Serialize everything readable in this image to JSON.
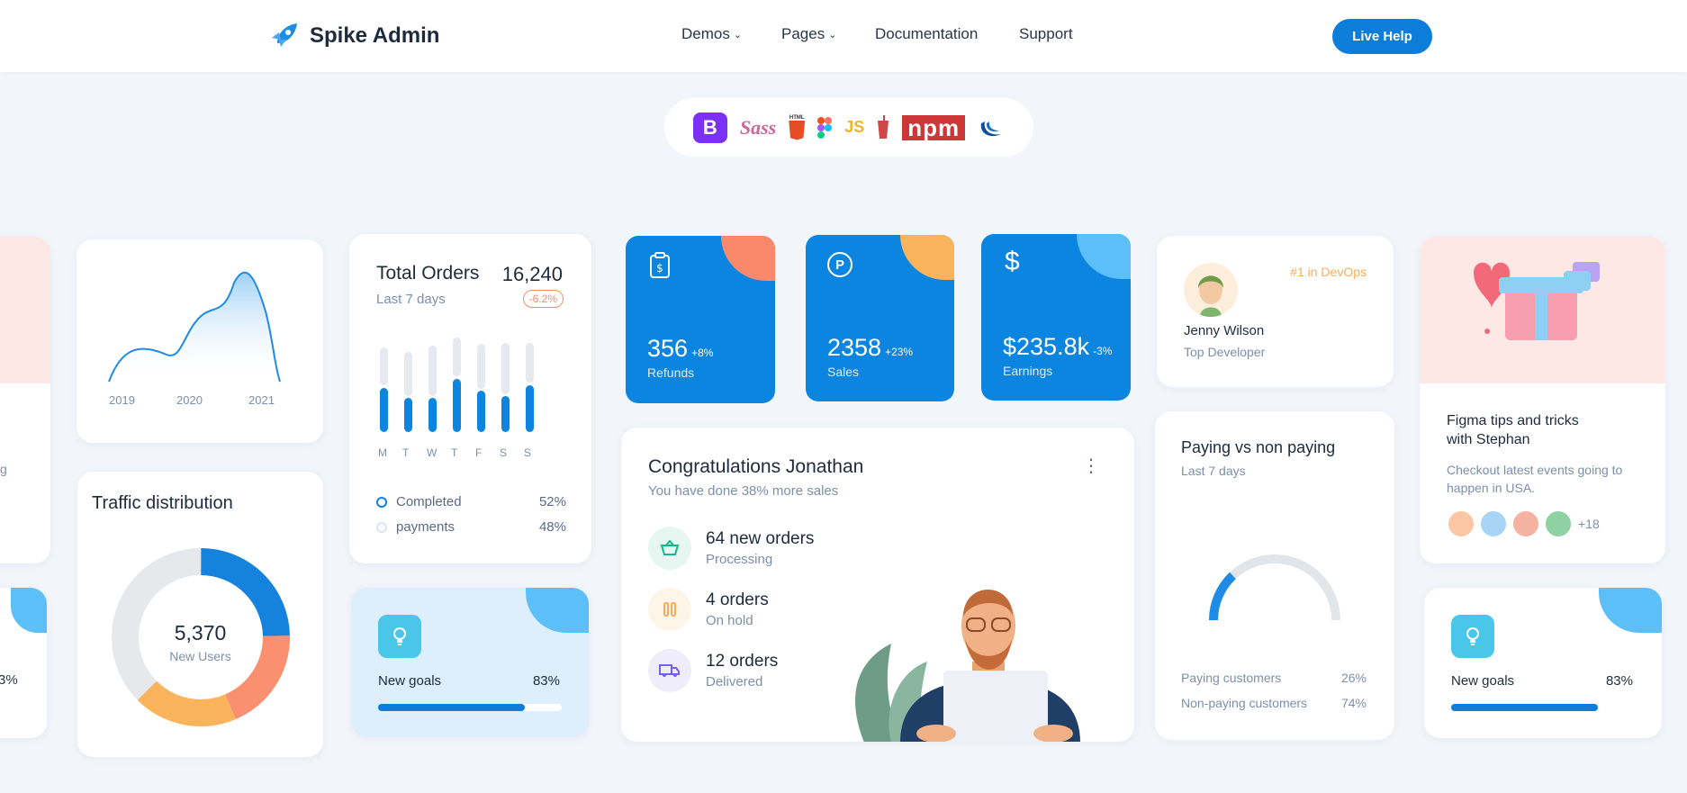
{
  "header": {
    "brand": "Spike Admin",
    "nav": [
      "Demos",
      "Pages",
      "Documentation",
      "Support"
    ],
    "live_help": "Live Help"
  },
  "tech": [
    "B",
    "Sass",
    "HTML",
    "JS",
    "npm"
  ],
  "area_chart": {
    "x": [
      "2019",
      "2020",
      "2021"
    ]
  },
  "total_orders": {
    "title": "Total Orders",
    "value": "16,240",
    "subtitle": "Last 7 days",
    "change": "-6.2%",
    "days": [
      "M",
      "T",
      "W",
      "T",
      "F",
      "S",
      "S"
    ],
    "bars": [
      52,
      40,
      40,
      62,
      48,
      42,
      55
    ],
    "legend": [
      {
        "label": "Completed",
        "value": "52%"
      },
      {
        "label": "payments",
        "value": "48%"
      }
    ]
  },
  "traffic": {
    "title": "Traffic distribution",
    "value": "5,370",
    "label": "New Users"
  },
  "stats": [
    {
      "value": "356",
      "change": "+8%",
      "label": "Refunds"
    },
    {
      "value": "2358",
      "change": "+23%",
      "label": "Sales"
    },
    {
      "value": "$235.8k",
      "change": "-3%",
      "label": "Earnings"
    }
  ],
  "congrats": {
    "title": "Congratulations Jonathan",
    "subtitle": "You have done 38% more sales",
    "orders": [
      {
        "title": "64 new orders",
        "sub": "Processing"
      },
      {
        "title": "4 orders",
        "sub": "On hold"
      },
      {
        "title": "12 orders",
        "sub": "Delivered"
      }
    ]
  },
  "goals": {
    "label": "New goals",
    "value": "83%",
    "progress": 0.83
  },
  "profile": {
    "badge": "#1 in DevOps",
    "name": "Jenny Wilson",
    "role": "Top Developer"
  },
  "paying": {
    "title": "Paying vs non paying",
    "subtitle": "Last 7 days",
    "rows": [
      {
        "label": "Paying customers",
        "value": "26%"
      },
      {
        "label": "Non-paying customers",
        "value": "74%"
      }
    ]
  },
  "figma": {
    "title": "Figma tips and tricks with Stephan",
    "desc": "Checkout latest events going to happen in USA.",
    "more": "+18"
  },
  "left_partial": {
    "text1": "g",
    "text2": "3%"
  },
  "colors": {
    "primary": "#0c85e0",
    "light": "#ddeefd",
    "orange": "#fbac58",
    "coral": "#fa896b"
  }
}
